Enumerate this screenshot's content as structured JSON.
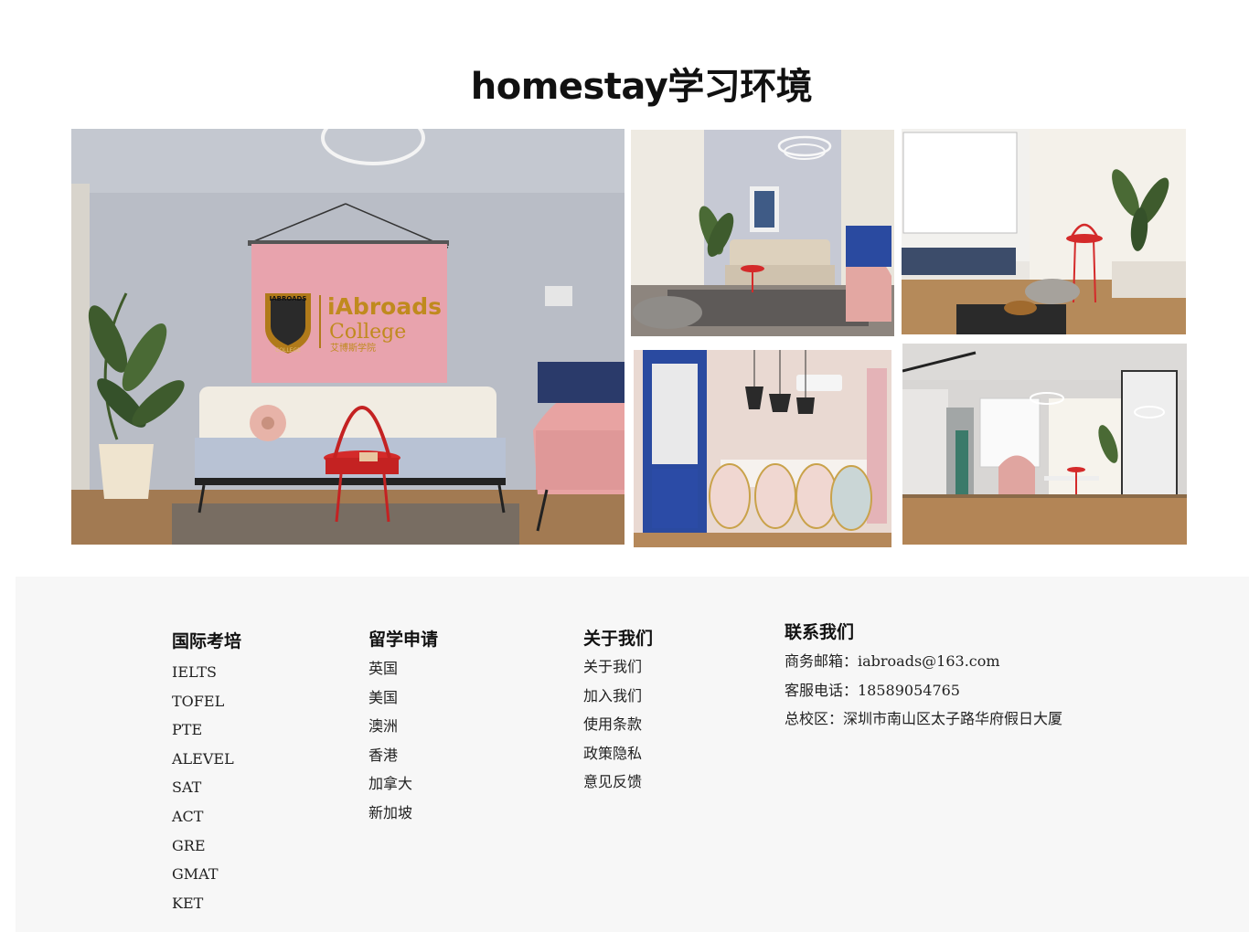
{
  "section": {
    "title": "homestay学习环境"
  },
  "gallery": {
    "photos": [
      {
        "name": "living-room-sofa-photo",
        "banner_line1": "iAbroads",
        "banner_line2": "College",
        "banner_line3": "艾博斯学院",
        "badge_line1": "IABROADS",
        "badge_line2": "COLLEGE"
      },
      {
        "name": "lounge-beige-sofa-photo"
      },
      {
        "name": "projector-screen-room-photo"
      },
      {
        "name": "dining-room-photo"
      },
      {
        "name": "study-hall-photo"
      }
    ]
  },
  "footer": {
    "exam": {
      "title": "国际考培",
      "items": [
        "IELTS",
        "TOFEL",
        "PTE",
        "ALEVEL",
        "SAT",
        "ACT",
        "GRE",
        "GMAT",
        "KET"
      ]
    },
    "study": {
      "title": "留学申请",
      "items": [
        "英国",
        "美国",
        "澳洲",
        "香港",
        "加拿大",
        "新加坡"
      ]
    },
    "about": {
      "title": "关于我们",
      "items": [
        "关于我们",
        "加入我们",
        "使用条款",
        "政策隐私",
        "意见反馈"
      ]
    },
    "contact": {
      "title": "联系我们",
      "items": [
        "商务邮箱：iabroads@163.com",
        "客服电话：18589054765",
        "总校区：深圳市南山区太子路华府假日大厦"
      ]
    }
  },
  "colors": {
    "banner_pink": "#e8a3ad",
    "wall_gray": "#b9bdc6",
    "accent_red": "#d42a2a",
    "blue_cabinet": "#2a4aa0",
    "footer_bg": "#f7f7f7"
  }
}
